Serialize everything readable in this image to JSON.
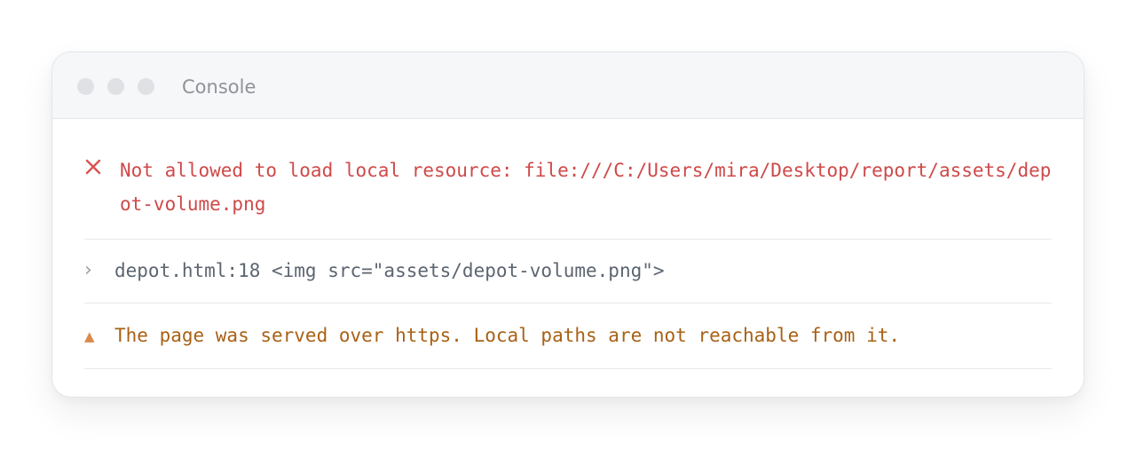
{
  "window": {
    "title": "Console"
  },
  "console": {
    "entries": [
      {
        "level": "error",
        "icon": "close-x-icon",
        "icon_glyph": "",
        "text": "Not allowed to load local resource: file:///C:/Users/mira/Desktop/report/assets/depot-volume.png"
      },
      {
        "level": "log",
        "icon": "chevron-right-icon",
        "icon_glyph": "›",
        "text": "depot.html:18 <img src=\"assets/depot-volume.png\">"
      },
      {
        "level": "warning",
        "icon": "warning-triangle-icon",
        "icon_glyph": "▲",
        "text": "The page was served over https. Local paths are not reachable from it."
      }
    ]
  },
  "colors": {
    "error": "#cf4949",
    "log": "#5c6570",
    "warning": "#a86116",
    "titlebar": "#f6f7f8",
    "dots": "#dfe1e4"
  }
}
